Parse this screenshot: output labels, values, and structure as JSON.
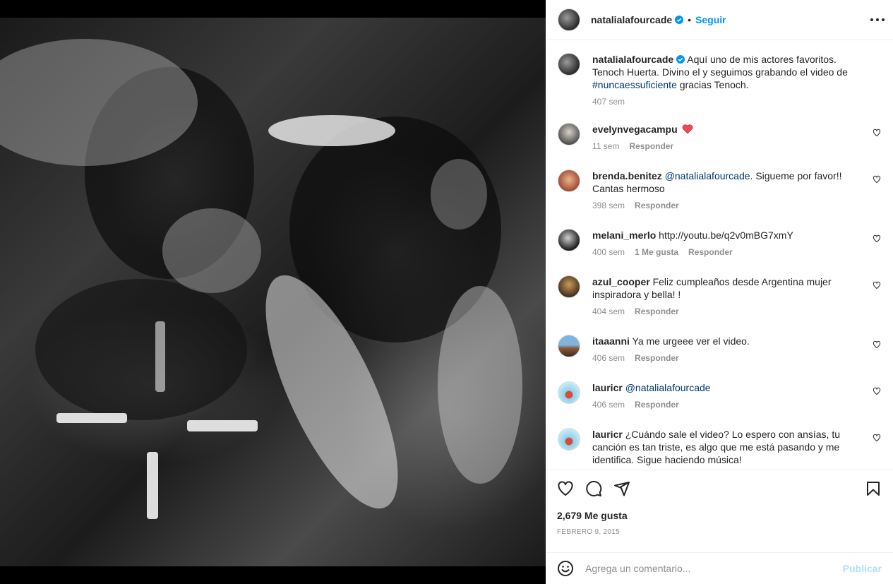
{
  "post": {
    "author": "natalialafourcade",
    "follow_label": "Seguir",
    "separator": "•",
    "caption_prefix": "Aquí uno de mis actores favoritos. Tenoch Huerta. Divino el y seguimos grabando el video de ",
    "caption_hashtag": "#nuncaessuficiente",
    "caption_suffix": " gracias Tenoch.",
    "caption_time": "407 sem",
    "likes": "2,679 Me gusta",
    "date": "FEBRERO 9, 2015"
  },
  "comments": [
    {
      "user": "evelynvegacampu",
      "text": "",
      "time": "11 sem",
      "likes": "",
      "reply": "Responder"
    },
    {
      "user": "brenda.benitez",
      "mention": "@natalialafourcade",
      "text": ". Sigueme por favor!! Cantas hermoso",
      "time": "398 sem",
      "likes": "",
      "reply": "Responder"
    },
    {
      "user": "melani_merlo",
      "text": "http://youtu.be/q2v0mBG7xmY",
      "time": "400 sem",
      "likes": "1 Me gusta",
      "reply": "Responder"
    },
    {
      "user": "azul_cooper",
      "text": "Feliz cumpleaños desde Argentina mujer inspiradora y bella! !",
      "time": "404 sem",
      "likes": "",
      "reply": "Responder"
    },
    {
      "user": "itaaanni",
      "text": "Ya me urgeee ver el video.",
      "time": "406 sem",
      "likes": "",
      "reply": "Responder"
    },
    {
      "user": "lauricr",
      "mention": "@natalialafourcade",
      "text": "",
      "time": "406 sem",
      "likes": "",
      "reply": "Responder"
    },
    {
      "user": "lauricr",
      "text": "¿Cuándo sale el video? Lo espero con ansías, tu canción es tan triste, es algo que me está pasando y me identifica. Sigue haciendo música!",
      "time": "",
      "likes": "",
      "reply": ""
    }
  ],
  "composer": {
    "placeholder": "Agrega un comentario...",
    "post_label": "Publicar"
  },
  "icons": {
    "verified": "verified-badge-icon",
    "more": "more-options-icon",
    "like": "heart-icon",
    "comment": "comment-icon",
    "share": "share-icon",
    "save": "bookmark-icon",
    "emoji": "emoji-icon"
  },
  "colors": {
    "accent": "#0095f6",
    "link": "#00376b",
    "muted": "#8e8e8e",
    "heart_red": "#ed4956",
    "post_disabled": "#b2dffc"
  }
}
